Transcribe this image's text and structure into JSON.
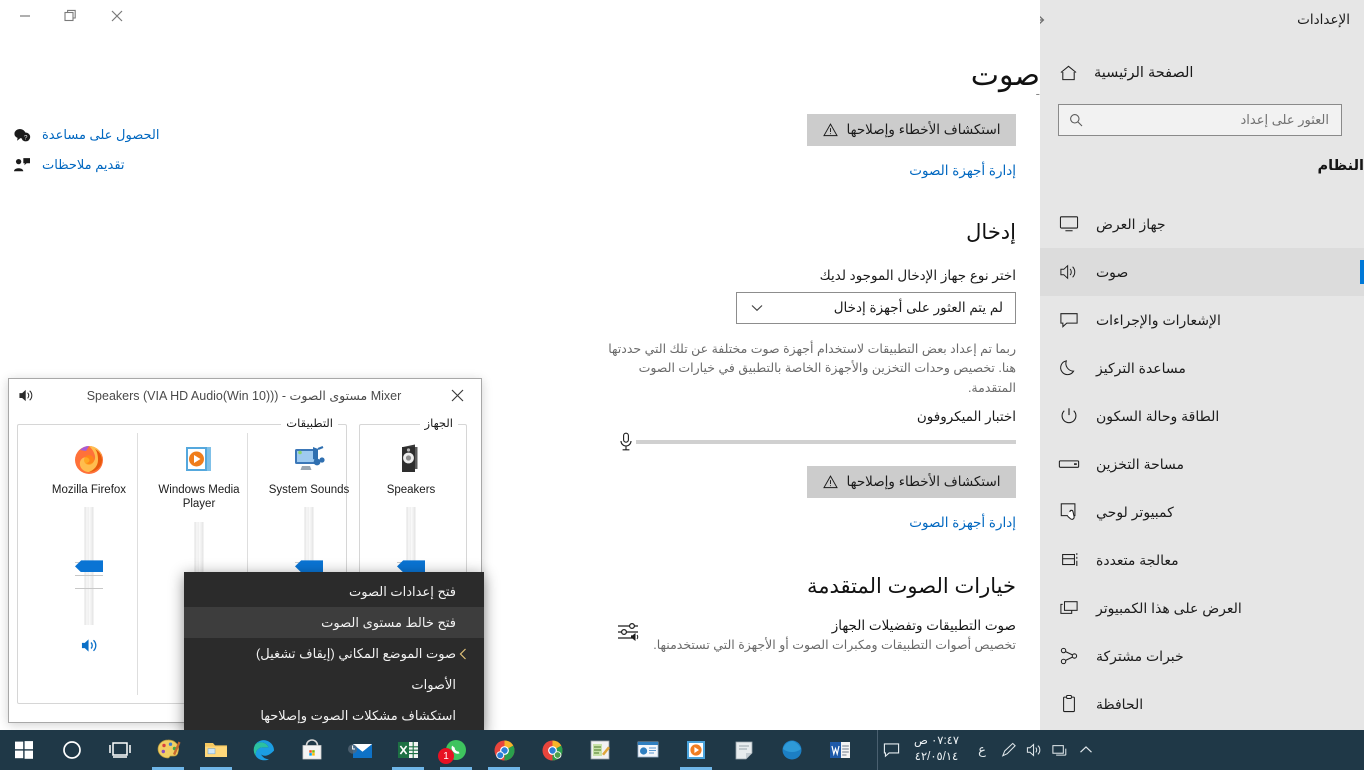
{
  "window": {
    "caption_buttons": [
      {
        "name": "close",
        "glyph": "close-icon"
      },
      {
        "name": "restore",
        "glyph": "restore-icon"
      },
      {
        "name": "minimize",
        "glyph": "minimize-icon"
      }
    ]
  },
  "sidebar": {
    "app_title": "الإعدادات",
    "back_label": "رجوع",
    "home_label": "الصفحة الرئيسية",
    "search_placeholder": "العثور على إعداد",
    "group_title": "النظام",
    "accent_color": "#0078d7",
    "background_color": "#e6e6e6",
    "items": [
      {
        "label": "جهاز العرض",
        "icon": "monitor-icon",
        "selected": false
      },
      {
        "label": "صوت",
        "icon": "speaker-icon",
        "selected": true
      },
      {
        "label": "الإشعارات والإجراءات",
        "icon": "notification-icon",
        "selected": false
      },
      {
        "label": "مساعدة التركيز",
        "icon": "moon-icon",
        "selected": false
      },
      {
        "label": "الطاقة وحالة السكون",
        "icon": "power-icon",
        "selected": false
      },
      {
        "label": "مساحة التخزين",
        "icon": "drive-icon",
        "selected": false
      },
      {
        "label": "كمبيوتر لوحي",
        "icon": "tablet-icon",
        "selected": false
      },
      {
        "label": "معالجة متعددة",
        "icon": "multitasking-icon",
        "selected": false
      },
      {
        "label": "العرض على هذا الكمبيوتر",
        "icon": "project-icon",
        "selected": false
      },
      {
        "label": "خبرات مشتركة",
        "icon": "shared-icon",
        "selected": false
      },
      {
        "label": "الحافظة",
        "icon": "clipboard-icon",
        "selected": false
      }
    ]
  },
  "main": {
    "page_title": "صوت",
    "dash": "-",
    "help_links": [
      {
        "label": "الحصول على مساعدة",
        "icon": "help-icon"
      },
      {
        "label": "تقديم ملاحظات",
        "icon": "feedback-icon"
      }
    ],
    "output": {
      "troubleshoot_label": "استكشاف الأخطاء وإصلاحها",
      "manage_link": "إدارة أجهزة الصوت"
    },
    "input": {
      "heading": "إدخال",
      "choose_label": "اختر نوع جهاز الإدخال الموجود لديك",
      "device_value": "لم يتم العثور على أجهزة إدخال",
      "app_note": "ربما تم إعداد بعض التطبيقات لاستخدام أجهزة صوت مختلفة عن تلك التي حددتها هنا. تخصيص وحدات التخزين والأجهزة الخاصة بالتطبيق في خيارات الصوت المتقدمة.",
      "mic_test_label": "اختبار الميكروفون",
      "mic_level": 0,
      "troubleshoot_label": "استكشاف الأخطاء وإصلاحها",
      "manage_link": "إدارة أجهزة الصوت"
    },
    "advanced": {
      "heading": "خيارات الصوت المتقدمة",
      "item_title": "صوت التطبيقات وتفضيلات الجهاز",
      "item_desc": "تخصيص أصوات التطبيقات ومكبرات الصوت أو الأجهزة التي تستخدمنها.",
      "icon": "mixer-icon"
    }
  },
  "mixer": {
    "title": "Mixer مستوى الصوت - (Speakers (VIA HD Audio(Win 10))",
    "close_label": "×",
    "icon": "volume-icon",
    "groups": [
      {
        "key": "device",
        "label": "الجهاز"
      },
      {
        "key": "apps",
        "label": "التطبيقات"
      }
    ],
    "device_channels": [
      {
        "name": "Speakers",
        "icon": "speaker-device-icon",
        "level": 50,
        "muted": false
      }
    ],
    "app_channels": [
      {
        "name": "System Sounds",
        "icon": "system-sounds-icon",
        "level": 50,
        "muted": false
      },
      {
        "name": "Windows Media Player",
        "icon": "wmp-icon",
        "level": 50,
        "muted": false
      },
      {
        "name": "Mozilla Firefox",
        "icon": "firefox-icon",
        "level": 50,
        "muted": false
      }
    ]
  },
  "context_menu": {
    "items": [
      {
        "label": "فتح إعدادات الصوت",
        "highlighted": false,
        "submenu": false
      },
      {
        "label": "فتح خالط مستوى الصوت",
        "highlighted": true,
        "submenu": false
      },
      {
        "label": "صوت الموضع المكاني (إيقاف تشغيل)",
        "highlighted": false,
        "submenu": true
      },
      {
        "label": "الأصوات",
        "highlighted": false,
        "submenu": false
      },
      {
        "label": "استكشاف مشكلات الصوت وإصلاحها",
        "highlighted": false,
        "submenu": false
      }
    ]
  },
  "taskbar": {
    "background_color": "#1f3847",
    "start_icon": "windows-start-icon",
    "pinned": [
      {
        "name": "cortana-icon",
        "active": false
      },
      {
        "name": "task-view-icon",
        "active": false
      },
      {
        "name": "paint-icon",
        "active": true
      },
      {
        "name": "file-explorer-icon",
        "active": true
      },
      {
        "name": "edge-icon",
        "active": false
      },
      {
        "name": "microsoft-store-icon",
        "active": false
      },
      {
        "name": "mail-icon",
        "active": false
      },
      {
        "name": "excel-icon",
        "active": true
      },
      {
        "name": "whatsapp-icon",
        "active": true,
        "badge": "1"
      },
      {
        "name": "chrome-blue-icon",
        "active": true
      },
      {
        "name": "chrome-icon",
        "active": false
      },
      {
        "name": "notepad-icon",
        "active": false
      },
      {
        "name": "powerpoint-icon",
        "active": false
      },
      {
        "name": "media-player-icon",
        "active": true
      },
      {
        "name": "sticky-notes-icon",
        "active": false
      },
      {
        "name": "browser-blue-icon",
        "active": false
      },
      {
        "name": "word-icon",
        "active": false
      }
    ],
    "tray": [
      {
        "name": "chevron-up-icon"
      },
      {
        "name": "network-icon"
      },
      {
        "name": "volume-tray-icon"
      },
      {
        "name": "pen-icon"
      },
      {
        "name": "language-indicator",
        "label": "ع"
      }
    ],
    "clock": {
      "time": "٠٧:٤٧ ص",
      "date": "٤٢/٠٥/١٤"
    },
    "action_center_icon": "action-center-icon"
  }
}
